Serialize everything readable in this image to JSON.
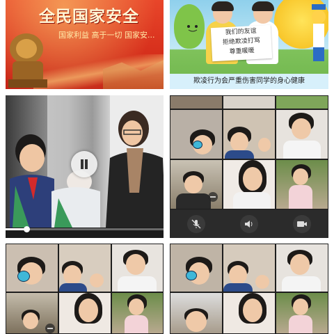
{
  "tile_banner": {
    "title": "全民国家安全",
    "subtitle": "国家利益 高于一切 国家安..."
  },
  "tile_poster": {
    "sign_lines": [
      "我们的友谊",
      "拒绝欺凌打骂",
      "尊重暖暖"
    ],
    "slogan": "欺凌行为会严重伤害同学的身心健康"
  },
  "video_player": {
    "state": "playing",
    "pause_icon": "pause-icon",
    "progress": 0.13
  },
  "video_call": {
    "controls": [
      {
        "name": "mute",
        "icon": "mic-off-icon"
      },
      {
        "name": "speaker",
        "icon": "speaker-icon"
      },
      {
        "name": "camera",
        "icon": "camera-icon"
      }
    ]
  },
  "colors": {
    "banner_red": "#d8311d",
    "banner_gold": "#fff6d6",
    "call_bg": "#2a2a2a",
    "control_bar": "#2b2b2b"
  }
}
